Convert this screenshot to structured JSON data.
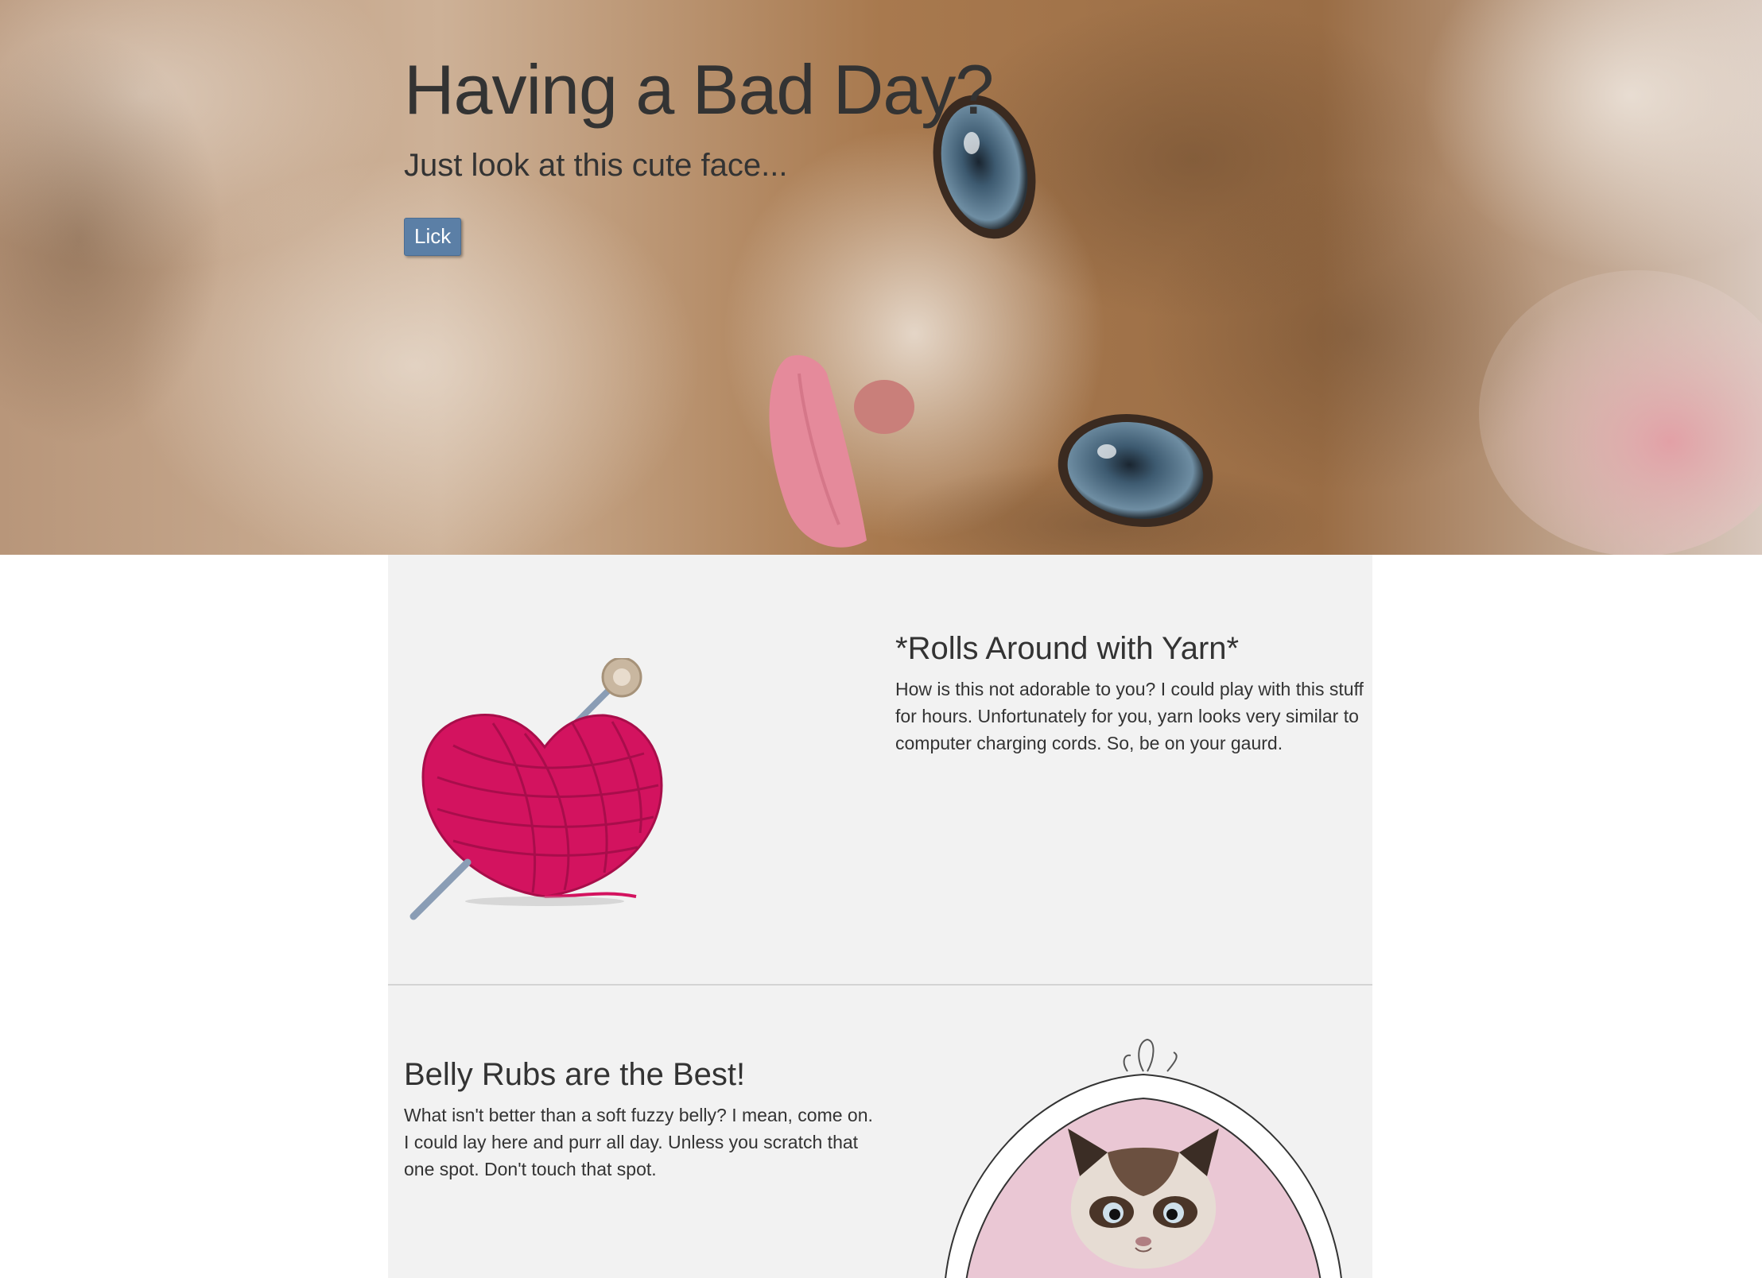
{
  "hero": {
    "title": "Having a Bad Day?",
    "subtitle": "Just look at this cute face...",
    "button_label": "Lick"
  },
  "sections": [
    {
      "heading": "*Rolls Around with Yarn*",
      "text": "How is this not adorable to you? I could play with this stuff for hours. Unfortunately for you, yarn looks very similar to computer charging cords. So, be on your gaurd."
    },
    {
      "heading": "Belly Rubs are the Best!",
      "text": "What isn't better than a soft fuzzy belly? I mean, come on. I could lay here and purr all day. Unless you scratch that one spot. Don't touch that spot."
    }
  ],
  "icons": {
    "hero_image": "kitten-face-image",
    "section_1_image": "yarn-heart-icon",
    "section_2_image": "grumpy-cat-mirror-image"
  },
  "colors": {
    "button": "#5b7fa6",
    "content_background": "#f2f2f2",
    "yarn": "#d3135f",
    "text": "#333333"
  }
}
